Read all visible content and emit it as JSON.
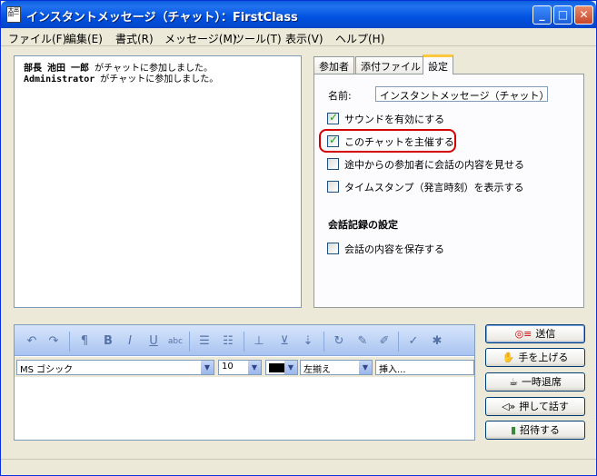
{
  "window": {
    "title": "インスタントメッセージ（チャット）：FirstClass",
    "app_icon_text": "大出田一"
  },
  "titlebar_buttons": {
    "minimize": "_",
    "maximize": "□",
    "close": "✕"
  },
  "menu": [
    "ファイル(F)",
    "編集(E)",
    "書式(R)",
    "メッセージ(M)",
    "ツール(T)",
    "表示(V)",
    "ヘルプ(H)"
  ],
  "chat_log": [
    {
      "name": "部長 池田 一郎",
      "text": " がチャットに参加しました。"
    },
    {
      "name": "Administrator",
      "text": " がチャットに参加しました。"
    }
  ],
  "tabs": [
    "参加者",
    "添付ファイル",
    "設定"
  ],
  "settings": {
    "name_label": "名前:",
    "name_value": "インスタントメッセージ（チャット）",
    "options": [
      {
        "label": "サウンドを有効にする",
        "checked": true
      },
      {
        "label": "このチャットを主催する",
        "checked": true
      },
      {
        "label": "途中からの参加者に会話の内容を見せる",
        "checked": false
      },
      {
        "label": "タイムスタンプ（発言時刻）を表示する",
        "checked": false
      }
    ],
    "section_title": "会話記録の設定",
    "save_option": {
      "label": "会話の内容を保存する",
      "checked": false
    }
  },
  "toolbar_icons": [
    "undo-icon",
    "redo-icon",
    "paragraph-icon",
    "bold-icon",
    "italic-icon",
    "underline-icon",
    "strikethrough-icon",
    "bullet-list-icon",
    "numbered-list-icon",
    "insert-line-icon",
    "insert-field-icon",
    "insert-link-icon",
    "refresh-icon",
    "pen-icon",
    "brush-icon",
    "spell-check-icon",
    "magic-icon"
  ],
  "format": {
    "font": "MS ゴシック",
    "size": "10",
    "align": "左揃え",
    "insert": "挿入..."
  },
  "actions": {
    "send": "送信",
    "raise_hand": "手を上げる",
    "away": "一時退席",
    "push_to_talk": "押して話す",
    "invite": "招待する"
  },
  "colors": {
    "highlight": "#d40000",
    "title_bar": "#0052e0"
  }
}
